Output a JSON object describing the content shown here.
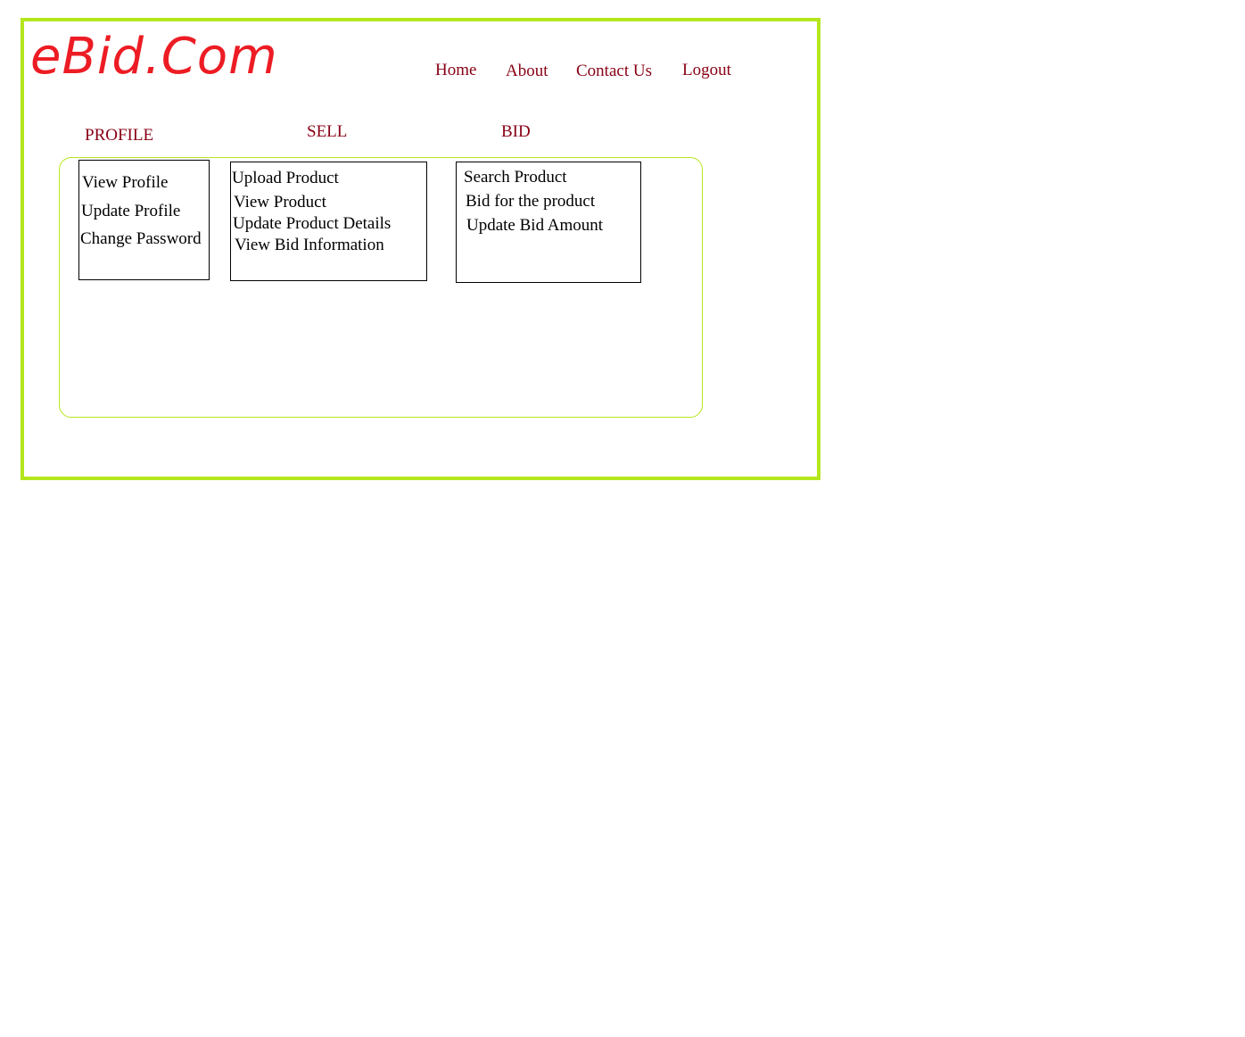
{
  "brand": {
    "logo_text": "eBid.Com",
    "logo_color": "#ed1c24",
    "frame_color": "#b5e61d"
  },
  "nav": {
    "home": "Home",
    "about": "About",
    "contact": "Contact Us",
    "logout": "Logout",
    "link_color": "#880015"
  },
  "sections": {
    "profile": {
      "title": "PROFILE",
      "items": [
        "View Profile",
        "Update Profile",
        "Change Password"
      ]
    },
    "sell": {
      "title": "SELL",
      "items": [
        "Upload Product",
        "View Product",
        "Update Product Details",
        "View Bid Information"
      ]
    },
    "bid": {
      "title": "BID",
      "items": [
        "Search Product",
        "Bid for the product",
        "Update Bid Amount"
      ]
    }
  }
}
